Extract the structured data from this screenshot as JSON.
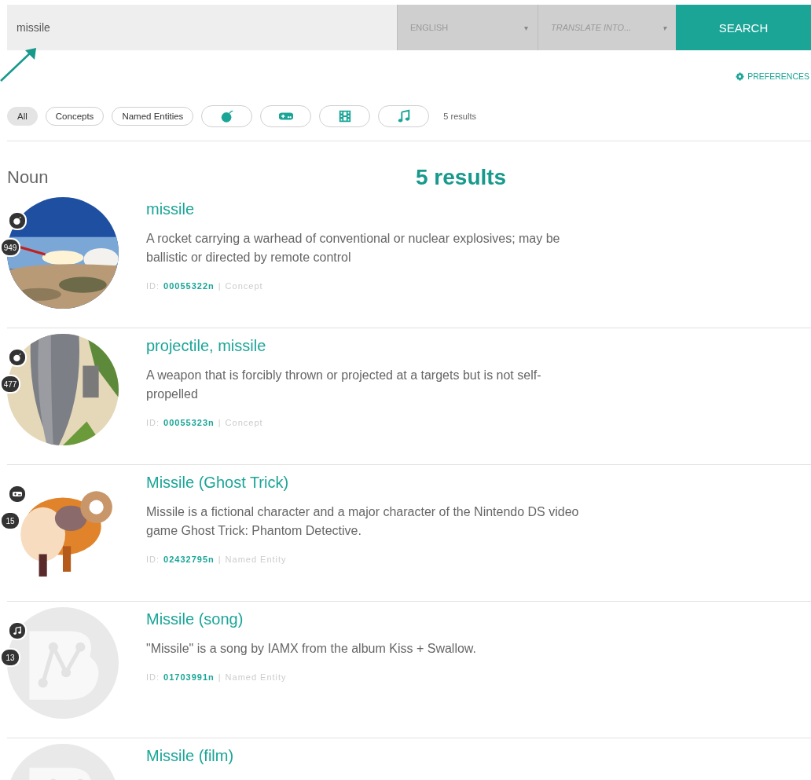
{
  "search": {
    "value": "missile",
    "source_language": "ENGLISH",
    "source_caret": "▾",
    "target_placeholder": "TRANSLATE INTO...",
    "target_caret": "▾",
    "button": "SEARCH"
  },
  "preferences": "PREFERENCES",
  "filters": [
    {
      "kind": "text",
      "label": "All",
      "selected": true
    },
    {
      "kind": "text",
      "label": "Concepts",
      "selected": false
    },
    {
      "kind": "text",
      "label": "Named Entities",
      "selected": false
    },
    {
      "kind": "bomb",
      "selected": false
    },
    {
      "kind": "gamepad",
      "selected": false
    },
    {
      "kind": "film",
      "selected": false
    },
    {
      "kind": "music",
      "selected": false
    }
  ],
  "result_count": "5 results",
  "annotation": {
    "label": "5 results"
  },
  "section": "Noun",
  "results": [
    {
      "kind": "picture",
      "badge": {
        "kind": "bomb"
      },
      "count": "949",
      "title": "missile",
      "description": "A rocket carrying a warhead of conventional or nuclear explosives; may be ballistic or directed by remote control",
      "id_label": "ID:",
      "id": "00055322n",
      "separator": "|",
      "type": "Concept"
    },
    {
      "kind": "picture",
      "badge": {
        "kind": "bomb"
      },
      "count": "477",
      "title": "projectile, missile",
      "description": "A weapon that is forcibly thrown or projected at a targets but is not self-propelled",
      "id_label": "ID:",
      "id": "00055323n",
      "separator": "|",
      "type": "Concept"
    },
    {
      "kind": "picture",
      "badge": {
        "kind": "gamepad"
      },
      "count": "15",
      "title": "Missile (Ghost Trick)",
      "description": "Missile is a fictional character and a major character of the Nintendo DS video game Ghost Trick: Phantom Detective.",
      "id_label": "ID:",
      "id": "02432795n",
      "separator": "|",
      "type": "Named Entity"
    },
    {
      "kind": "placeholder",
      "badge": {
        "kind": "music"
      },
      "count": "13",
      "title": "Missile (song)",
      "description": "\"Missile\" is a song by IAMX from the album Kiss + Swallow.",
      "id_label": "ID:",
      "id": "01703991n",
      "separator": "|",
      "type": "Named Entity"
    },
    {
      "kind": "placeholder",
      "title": "Missile (film)"
    }
  ]
}
